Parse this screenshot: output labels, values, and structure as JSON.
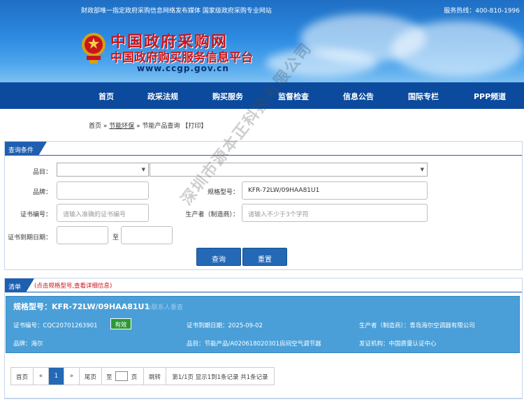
{
  "header": {
    "tagline": "财政部唯一指定政府采购信息网络发布媒体 国家级政府采购专业网站",
    "hotline": "服务热线：400-810-1996",
    "logo_title": "中国政府采购网",
    "logo_subtitle": "中国政府购买服务信息平台",
    "logo_url": "www.ccgp.gov.cn"
  },
  "nav": [
    "首页",
    "政采法规",
    "购买服务",
    "监督检查",
    "信息公告",
    "国际专栏",
    "PPP频道"
  ],
  "breadcrumb": {
    "home": "首页",
    "sep1": " » ",
    "section": "节能环保",
    "sep2": " » ",
    "page": "节能产品查询",
    "print": "【打印】"
  },
  "query": {
    "tab": "查询条件",
    "category_label": "品目：",
    "brand_label": "品牌：",
    "model_label": "规格型号：",
    "model_value": "KFR-72LW/09HAA81U1",
    "cert_label": "证书编号：",
    "cert_placeholder": "请输入准确的证书编号",
    "maker_label": "生产者（制造商）：",
    "maker_placeholder": "请输入不少于3个字符",
    "expiry_label": "证书到期日期：",
    "to_label": "至",
    "search_btn": "查询",
    "reset_btn": "重置"
  },
  "list": {
    "tab": "清单",
    "hint": "(点击规格型号,查看详细信息)",
    "item": {
      "title": "规格型号：KFR-72LW/09HAA81U1",
      "contact": "◎联系人垂查",
      "cert_no": "证书编号：CQC20701263901",
      "status": "有效",
      "expiry": "证书到期日期：2025-09-02",
      "maker": "生产者（制造商）：青岛海尔空调器有限公司",
      "brand": "品牌：海尔",
      "category": "品目：节能产品/A020618020301房间空气调节器",
      "issuer": "发证机构：中国质量认证中心"
    },
    "status_color": "#2a9a36"
  },
  "pager": {
    "first": "首页",
    "prev": "«",
    "current": "1",
    "next": "»",
    "last": "尾页",
    "goto_prefix": "至",
    "goto_suffix": "页",
    "jump": "跳转",
    "summary": "第1/1页 显示1到1条记录 共1条记录"
  },
  "watermark": "深圳市源本正科技有限公司",
  "icons": [
    "national-emblem-icon",
    "dropdown-arrow-icon"
  ]
}
